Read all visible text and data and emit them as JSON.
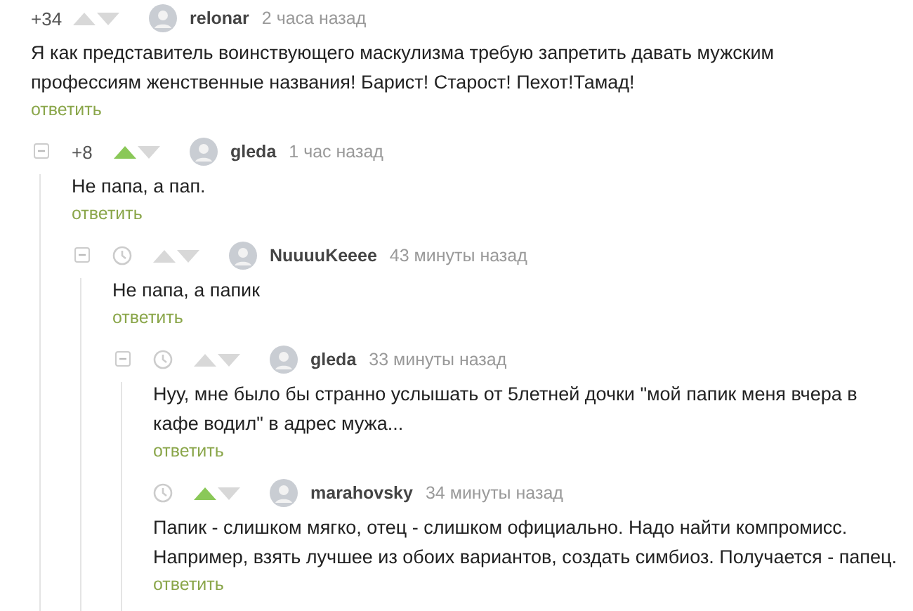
{
  "comments": [
    {
      "score": "+34",
      "voted_up": false,
      "author": "relonar",
      "time": "2 часа назад",
      "text": "Я как представитель воинствующего маскулизма требую запретить давать мужским профессиям женственные названия! Барист! Старост! Пехот!Тамад!",
      "reply": "ответить",
      "children": [
        {
          "score": "+8",
          "voted_up": true,
          "expanded": true,
          "author": "gleda",
          "time": "1 час назад",
          "text": "Не папа, а пап.",
          "reply": "ответить",
          "children": [
            {
              "voted_up": false,
              "expanded": true,
              "author": "NuuuuKeeee",
              "time": "43 минуты назад",
              "text": "Не папа, а папик",
              "reply": "ответить",
              "children": [
                {
                  "voted_up": false,
                  "expanded": true,
                  "author": "gleda",
                  "time": "33 минуты назад",
                  "text": "Нуу, мне было бы странно услышать от 5летней дочки \"мой папик меня вчера в кафе водил\" в адрес мужа...",
                  "reply": "ответить",
                  "children": [
                    {
                      "voted_up": true,
                      "author": "marahovsky",
                      "time": "34 минуты назад",
                      "text": "Папик - слишком мягко, отец - слишком официально. Надо найти компромисс. Например, взять лучшее из обоих вариантов, создать симбиоз. Получается - папец.",
                      "reply": "ответить"
                    }
                  ]
                }
              ]
            }
          ]
        }
      ]
    }
  ]
}
